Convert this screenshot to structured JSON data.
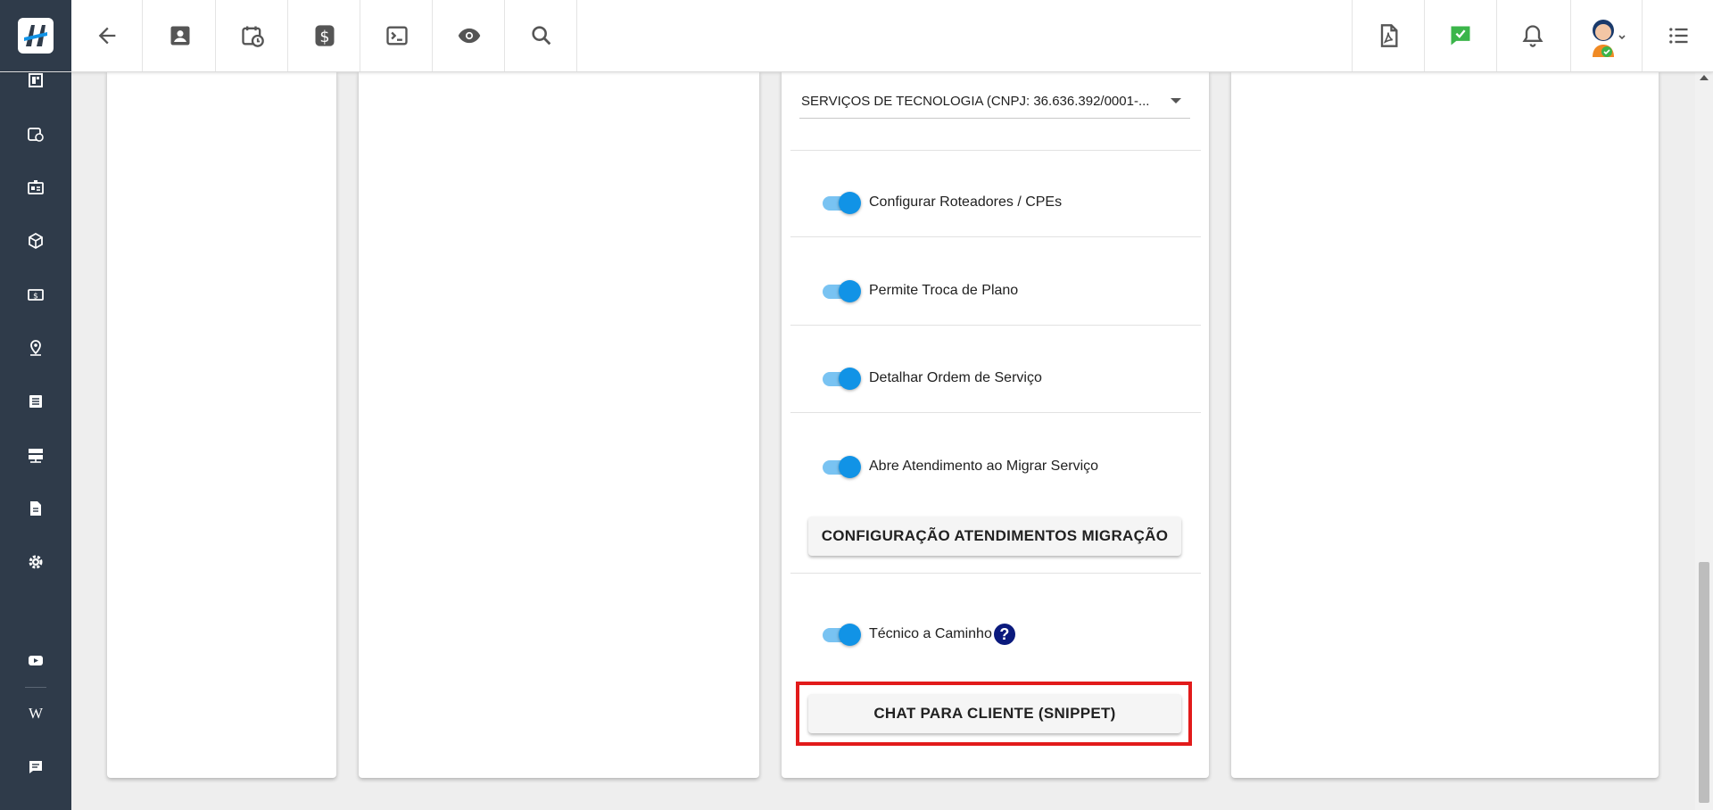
{
  "colors": {
    "sidebar_bg": "#2f3b4a",
    "toggle_on": "#1193e6",
    "highlight": "#e21b1b",
    "help_icon": "#0b1a7d",
    "chat_icon": "#3bb54a"
  },
  "toolbar": {
    "left_icons": [
      "arrow-left-icon",
      "contact-card-icon",
      "calendar-clock-icon",
      "dollar-icon",
      "terminal-icon",
      "eye-icon",
      "search-icon"
    ],
    "right_icons": [
      "pdf-icon",
      "chat-check-icon",
      "bell-icon",
      "avatar",
      "list-icon"
    ]
  },
  "sidebar": {
    "icons": [
      "dashboard-icon",
      "calendar-clock-icon",
      "id-card-icon",
      "box-icon",
      "money-icon",
      "location-icon",
      "list-alt-icon",
      "server-icon",
      "document-icon",
      "settings-icon",
      "youtube-icon",
      "wikipedia-icon",
      "message-icon"
    ],
    "wiki_glyph": "W"
  },
  "form": {
    "company_select": {
      "value": "SERVIÇOS DE TECNOLOGIA (CNPJ: 36.636.392/0001-..."
    },
    "toggles": [
      {
        "label": "Configurar Roteadores / CPEs",
        "enabled": true
      },
      {
        "label": "Permite Troca de Plano",
        "enabled": true
      },
      {
        "label": "Detalhar Ordem de Serviço",
        "enabled": true
      },
      {
        "label": "Abre Atendimento ao Migrar Serviço",
        "enabled": true
      },
      {
        "label": "Técnico a Caminho",
        "enabled": true
      }
    ],
    "help_glyph": "?",
    "migration_button": "CONFIGURAÇÃO ATENDIMENTOS MIGRAÇÃO",
    "chat_button": "CHAT PARA CLIENTE (SNIPPET)"
  }
}
